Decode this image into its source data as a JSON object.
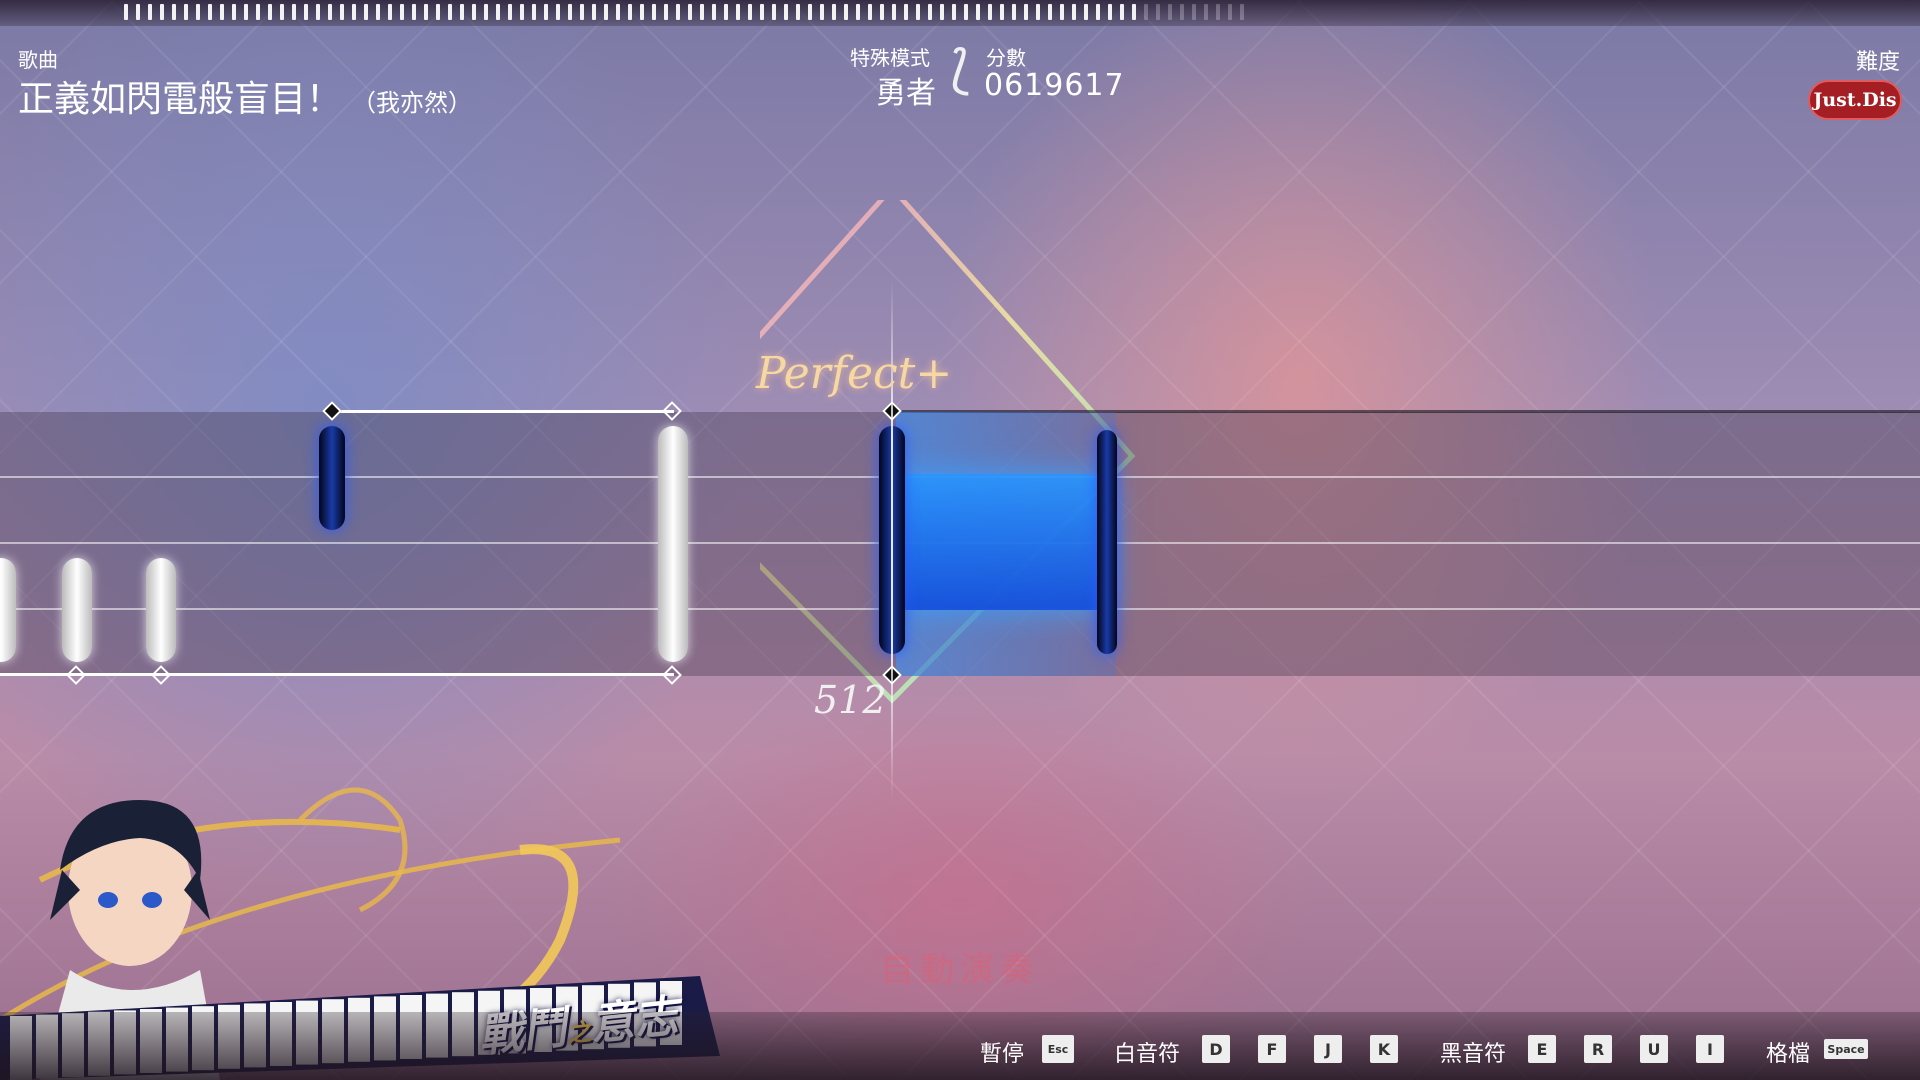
{
  "song": {
    "label": "歌曲",
    "title": "正義如閃電般盲目！",
    "artist": "（我亦然）"
  },
  "mode": {
    "label": "特殊模式",
    "value": "勇者"
  },
  "score": {
    "label": "分數",
    "value": "0619617"
  },
  "difficulty": {
    "label": "難度",
    "value": "Just.Dis"
  },
  "judgement": {
    "text": "Perfect+",
    "combo": "512"
  },
  "autoplay": "自動演奏",
  "controls": {
    "pause_label": "暫停",
    "pause_key": "Esc",
    "white_label": "白音符",
    "white_keys": [
      "D",
      "F",
      "J",
      "K"
    ],
    "black_label": "黑音符",
    "black_keys": [
      "E",
      "R",
      "U",
      "I"
    ],
    "screenshot_label": "格檔",
    "screenshot_key": "Space"
  },
  "banner": {
    "big": "戰鬥",
    "small": "之",
    "big2": "意志"
  },
  "progress": 0.9,
  "colors": {
    "accent_red": "#a51e23",
    "white_note": "#ffffff",
    "black_note": "#1a3aa8",
    "hold_blue": "#2896ff"
  }
}
